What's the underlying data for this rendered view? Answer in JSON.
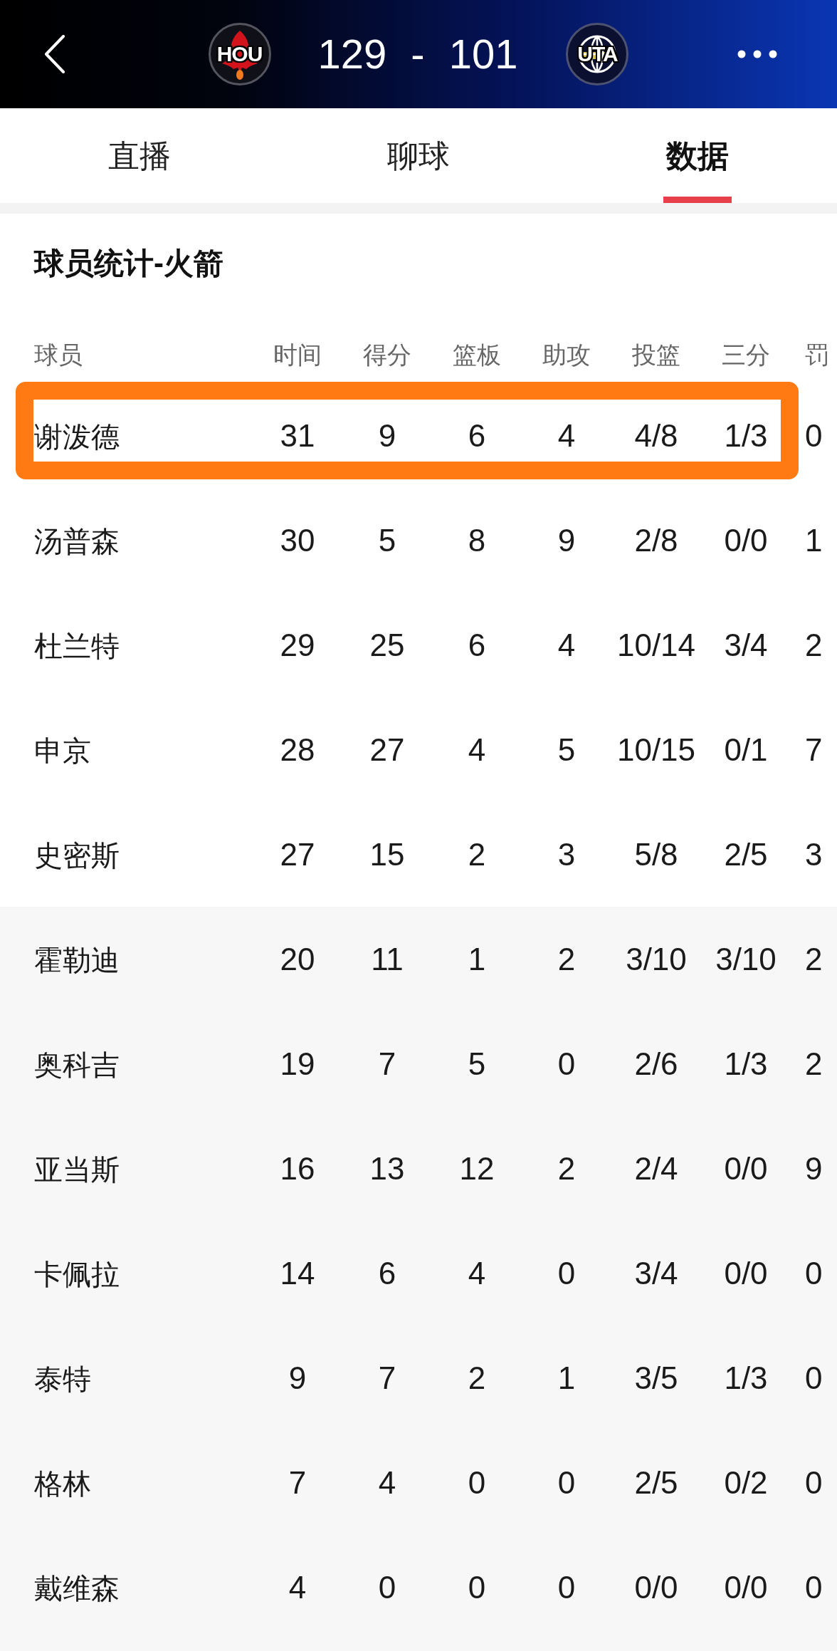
{
  "header": {
    "home_team": "HOU",
    "home_score": "129",
    "separator": "-",
    "away_score": "101",
    "away_team": "UTA"
  },
  "tabs": [
    {
      "label": "直播",
      "selected": false
    },
    {
      "label": "聊球",
      "selected": false
    },
    {
      "label": "数据",
      "selected": true
    }
  ],
  "section_title": "球员统计-火箭",
  "table": {
    "columns": [
      "球员",
      "时间",
      "得分",
      "篮板",
      "助攻",
      "投篮",
      "三分",
      "罚"
    ],
    "sections": [
      {
        "kind": "starters",
        "rows": [
          {
            "highlighted": true,
            "cells": [
              "谢泼德",
              "31",
              "9",
              "6",
              "4",
              "4/8",
              "1/3",
              "0"
            ]
          },
          {
            "highlighted": false,
            "cells": [
              "汤普森",
              "30",
              "5",
              "8",
              "9",
              "2/8",
              "0/0",
              "1"
            ]
          },
          {
            "highlighted": false,
            "cells": [
              "杜兰特",
              "29",
              "25",
              "6",
              "4",
              "10/14",
              "3/4",
              "2"
            ]
          },
          {
            "highlighted": false,
            "cells": [
              "申京",
              "28",
              "27",
              "4",
              "5",
              "10/15",
              "0/1",
              "7"
            ]
          },
          {
            "highlighted": false,
            "cells": [
              "史密斯",
              "27",
              "15",
              "2",
              "3",
              "5/8",
              "2/5",
              "3"
            ]
          }
        ]
      },
      {
        "kind": "bench",
        "rows": [
          {
            "highlighted": false,
            "cells": [
              "霍勒迪",
              "20",
              "11",
              "1",
              "2",
              "3/10",
              "3/10",
              "2"
            ]
          },
          {
            "highlighted": false,
            "cells": [
              "奥科吉",
              "19",
              "7",
              "5",
              "0",
              "2/6",
              "1/3",
              "2"
            ]
          },
          {
            "highlighted": false,
            "cells": [
              "亚当斯",
              "16",
              "13",
              "12",
              "2",
              "2/4",
              "0/0",
              "9"
            ]
          },
          {
            "highlighted": false,
            "cells": [
              "卡佩拉",
              "14",
              "6",
              "4",
              "0",
              "3/4",
              "0/0",
              "0"
            ]
          },
          {
            "highlighted": false,
            "cells": [
              "泰特",
              "9",
              "7",
              "2",
              "1",
              "3/5",
              "1/3",
              "0"
            ]
          },
          {
            "highlighted": false,
            "cells": [
              "格林",
              "7",
              "4",
              "0",
              "0",
              "2/5",
              "0/2",
              "0"
            ]
          },
          {
            "highlighted": false,
            "cells": [
              "戴维森",
              "4",
              "0",
              "0",
              "0",
              "0/0",
              "0/0",
              "0"
            ]
          }
        ]
      }
    ]
  }
}
